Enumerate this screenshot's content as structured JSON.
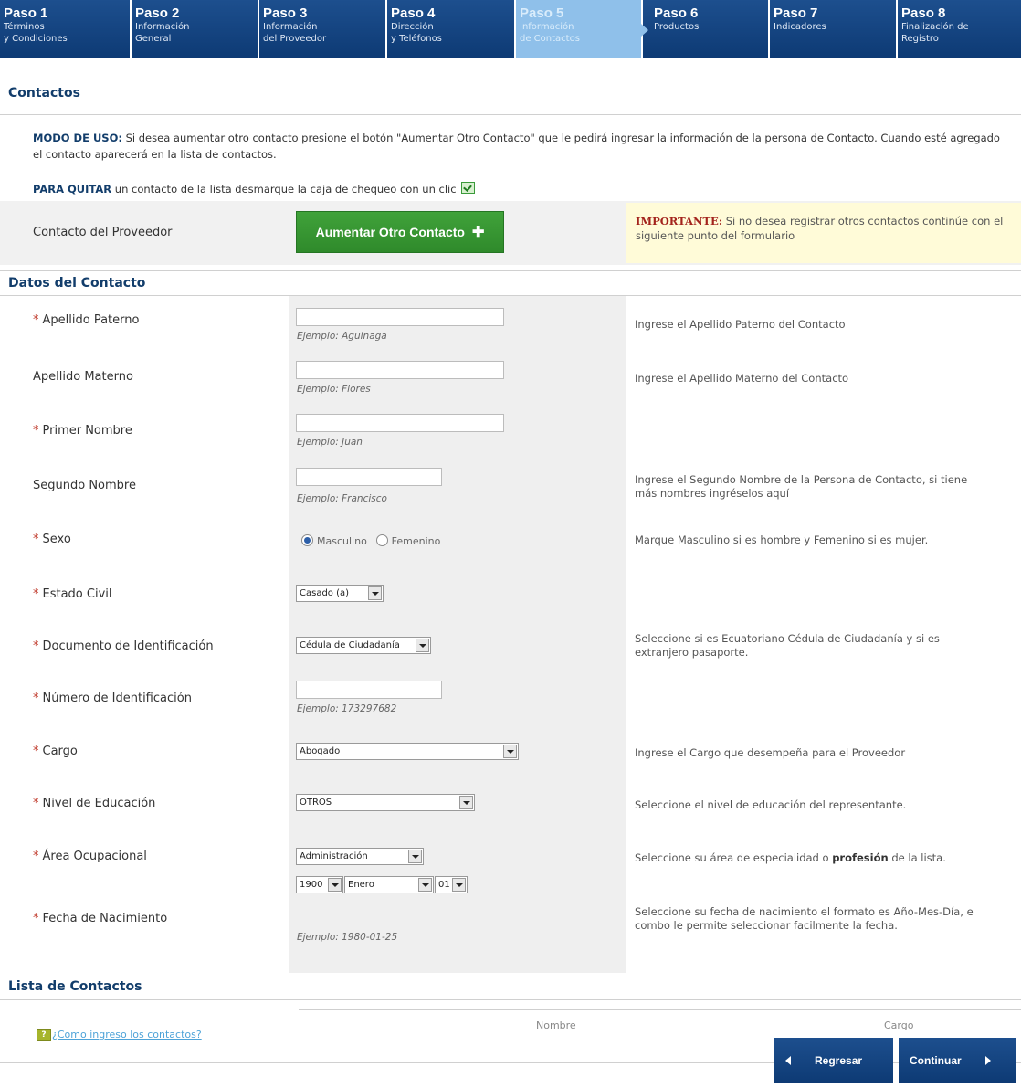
{
  "steps": [
    {
      "num": "Paso 1",
      "label": "Términos\ny Condiciones"
    },
    {
      "num": "Paso 2",
      "label": "Información\nGeneral"
    },
    {
      "num": "Paso 3",
      "label": "Información\ndel Proveedor"
    },
    {
      "num": "Paso 4",
      "label": "Dirección\ny Teléfonos"
    },
    {
      "num": "Paso 5",
      "label": "Información\nde Contactos"
    },
    {
      "num": "Paso 6",
      "label": "Productos"
    },
    {
      "num": "Paso 7",
      "label": "Indicadores"
    },
    {
      "num": "Paso 8",
      "label": "Finalización de\nRegistro"
    }
  ],
  "active_step_index": 4,
  "section_contactos": "Contactos",
  "usage": {
    "bold": "MODO DE USO:",
    "text": " Si desea aumentar otro contacto presione el botón \"Aumentar Otro Contacto\" que le pedirá ingresar la información de la persona de Contacto. Cuando esté agregado el contacto aparecerá en la lista de contactos."
  },
  "quitar": {
    "bold": "PARA QUITAR",
    "text": " un contacto de la lista desmarque la caja de chequeo con un clic"
  },
  "proveedor": {
    "label": "Contacto del Proveedor",
    "add_button": "Aumentar Otro Contacto",
    "important_bold": "IMPORTANTE:",
    "important_text": " Si no desea registrar otros contactos continúe con el siguiente punto del formulario"
  },
  "section_datos": "Datos del Contacto",
  "fields": {
    "apellido_paterno": {
      "label": "Apellido Paterno",
      "example": "Ejemplo: Aguinaga",
      "help": "Ingrese el Apellido Paterno del Contacto",
      "value": ""
    },
    "apellido_materno": {
      "label": "Apellido Materno",
      "example": "Ejemplo: Flores",
      "help": "Ingrese el Apellido Materno del Contacto",
      "value": ""
    },
    "primer_nombre": {
      "label": "Primer Nombre",
      "example": "Ejemplo: Juan",
      "help": "",
      "value": ""
    },
    "segundo_nombre": {
      "label": "Segundo Nombre",
      "example": "Ejemplo: Francisco",
      "help": "Ingrese el Segundo Nombre de la Persona de Contacto, si tiene\nmás nombres ingréselos aquí",
      "value": ""
    },
    "sexo": {
      "label": "Sexo",
      "option_1": "Masculino",
      "option_2": "Femenino",
      "help": "Marque Masculino si es hombre y Femenino si es mujer."
    },
    "estado_civil": {
      "label": "Estado Civil",
      "selected": "Casado (a)"
    },
    "documento": {
      "label": "Documento de Identificación",
      "selected": "Cédula de Ciudadanía",
      "help": "Seleccione si es Ecuatoriano Cédula de Ciudadanía y si es\nextranjero pasaporte."
    },
    "numero_id": {
      "label": "Número de Identificación",
      "example": "Ejemplo: 173297682",
      "value": ""
    },
    "cargo": {
      "label": "Cargo",
      "selected": "Abogado",
      "help": "Ingrese el Cargo que desempeña para el Proveedor"
    },
    "educacion": {
      "label": "Nivel de Educación",
      "selected": "OTROS",
      "help": "Seleccione el nivel de educación del representante."
    },
    "area": {
      "label": "Área Ocupacional",
      "selected": "Administración",
      "help_pre": "Seleccione su área de especialidad o ",
      "help_bold": "profesión",
      "help_post": " de la lista."
    },
    "nacimiento": {
      "label": "Fecha de Nacimiento",
      "year": "1900",
      "month": "Enero",
      "day": "01",
      "example": "Ejemplo: 1980-01-25",
      "help": "Seleccione su fecha de nacimiento el formato es Año-Mes-Día, e\ncombo le permite seleccionar facilmente la fecha."
    }
  },
  "section_lista": "Lista de Contactos",
  "lista": {
    "help_link": "¿Como ingreso los contactos?",
    "col_nombre": "Nombre",
    "col_cargo": "Cargo"
  },
  "nav": {
    "back": "Regresar",
    "next": "Continuar"
  },
  "colors": {
    "nav_blue": "#0d3a74",
    "active_step": "#8fc0ea",
    "add_green": "#2f8a2b",
    "important_red": "#a3231c"
  }
}
